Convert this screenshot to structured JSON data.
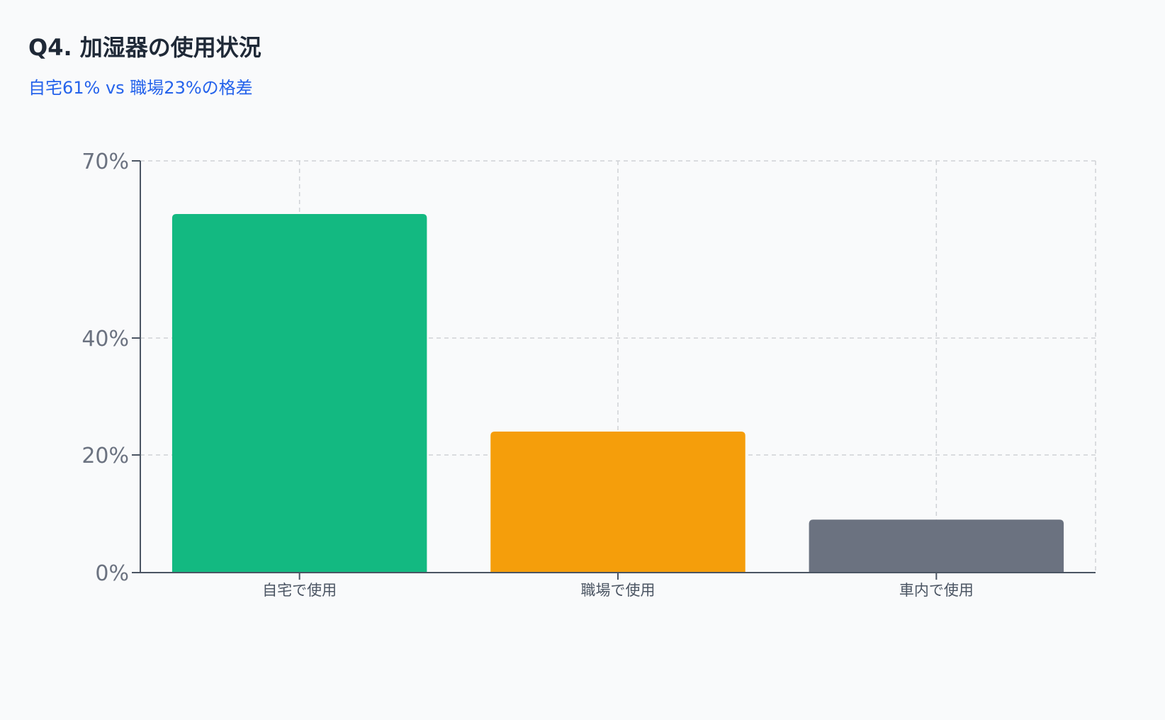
{
  "header": {
    "title": "Q4. 加湿器の使用状況",
    "subtitle": "自宅61% vs 職場23%の格差"
  },
  "colors": {
    "title": "#1f2937",
    "subtitle": "#2563eb",
    "grid": "#cfd2d6",
    "axis": "#4b5563"
  },
  "chart_data": {
    "type": "bar",
    "categories": [
      "自宅で使用",
      "職場で使用",
      "車内で使用"
    ],
    "values": [
      61,
      24,
      9
    ],
    "colors": [
      "#13b981",
      "#f59e0b",
      "#6b7280"
    ],
    "yticks": [
      0,
      20,
      40,
      70
    ],
    "ytick_labels": [
      "0%",
      "20%",
      "40%",
      "70%"
    ],
    "ylim": [
      0,
      70
    ],
    "grid": true
  }
}
